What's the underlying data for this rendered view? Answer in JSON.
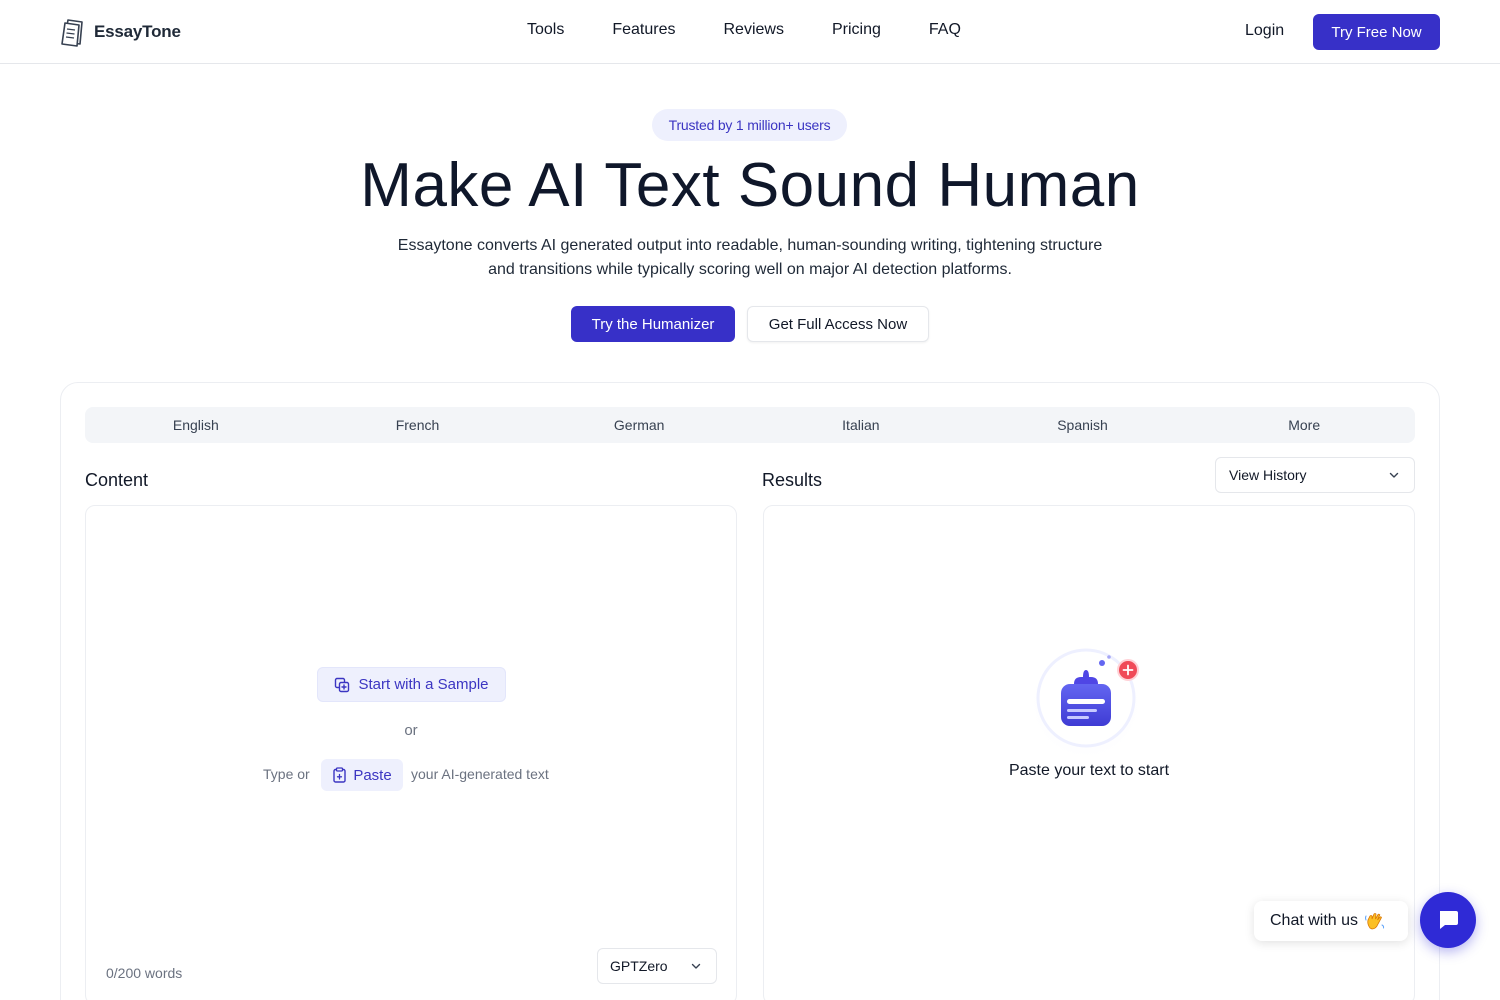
{
  "header": {
    "brand": "EssayTone",
    "nav": [
      "Tools",
      "Features",
      "Reviews",
      "Pricing",
      "FAQ"
    ],
    "login": "Login",
    "cta": "Try Free Now"
  },
  "hero": {
    "badge": "Trusted by 1 million+ users",
    "title": "Make AI Text Sound Human",
    "description": "Essaytone converts AI generated output into readable, human-sounding writing, tightening structure and transitions while typically scoring well on major AI detection platforms.",
    "primary_button": "Try the Humanizer",
    "secondary_button": "Get Full Access Now"
  },
  "languages": [
    "English",
    "French",
    "German",
    "Italian",
    "Spanish",
    "More"
  ],
  "content": {
    "title": "Content",
    "sample_button": "Start with a Sample",
    "or": "or",
    "type_or": "Type or",
    "paste_button": "Paste",
    "your_text": "your AI-generated text",
    "word_count": "0/200 words",
    "detector": "GPTZero"
  },
  "results": {
    "title": "Results",
    "history": "View History",
    "empty": "Paste your text to start"
  },
  "chat": {
    "label": "Chat with us"
  },
  "colors": {
    "primary": "#3730c8",
    "badge_bg": "#eef0fd",
    "accent_red": "#f04a58"
  }
}
